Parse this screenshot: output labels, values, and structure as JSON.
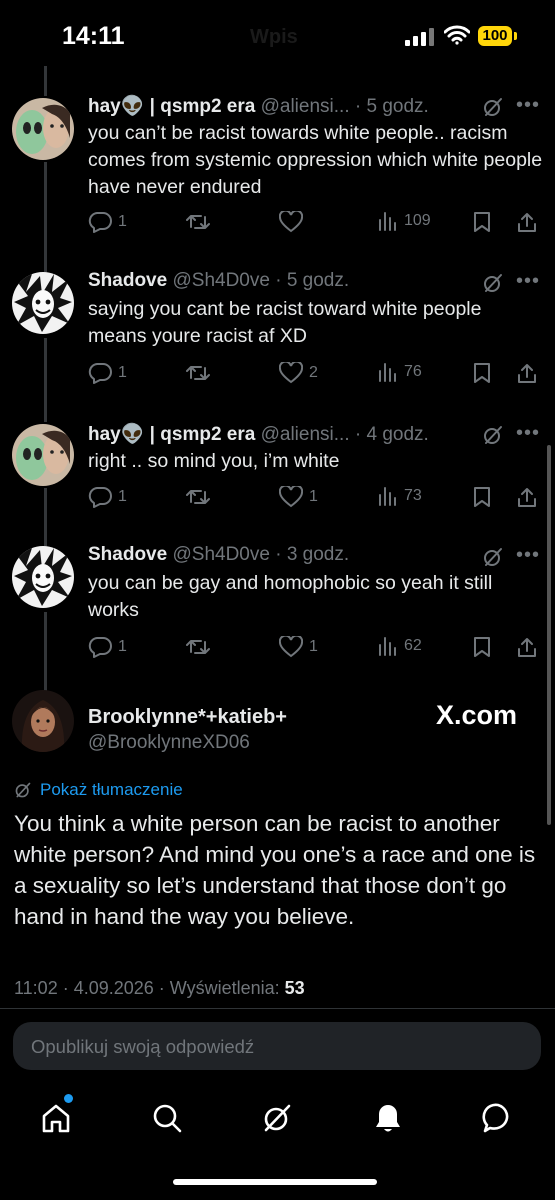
{
  "status_bar": {
    "time": "14:11",
    "battery": "100",
    "title": "Wpis"
  },
  "tweets": [
    {
      "name": "hay👽 | qsmp2 era",
      "handle": "@aliensi...",
      "time": "5 godz.",
      "text": "you can’t be racist towards white people.. racism comes from systemic oppression which white people have never endured",
      "replies": "1",
      "reposts": "",
      "likes": "",
      "views": "109"
    },
    {
      "name": "Shadove",
      "handle": "@Sh4D0ve",
      "time": "5 godz.",
      "text": "saying you cant be racist toward white people means youre racist af XD",
      "replies": "1",
      "reposts": "",
      "likes": "2",
      "views": "76"
    },
    {
      "name": "hay👽 | qsmp2 era",
      "handle": "@aliensi...",
      "time": "4 godz.",
      "text": "right .. so mind you, i’m white",
      "replies": "1",
      "reposts": "",
      "likes": "1",
      "views": "73"
    },
    {
      "name": "Shadove",
      "handle": "@Sh4D0ve",
      "time": "3 godz.",
      "text": "you can be gay and homophobic so yeah it still works",
      "replies": "1",
      "reposts": "",
      "likes": "1",
      "views": "62"
    }
  ],
  "main_tweet": {
    "name": "Brooklynne*+katieb+",
    "handle": "@BrooklynneXD06",
    "watermark": "X.com",
    "translate_label": "Pokaż tłumaczenie",
    "text": "You think a white person can be racist to another white person? And mind you one’s a race and one is a sexuality so let’s understand that those don’t go hand in hand the way you believe.",
    "time_date": "11:02 · 4.09.2026 · Wyświetlenia: ",
    "views": "53"
  },
  "reply_box": {
    "placeholder": "Opublikuj swoją odpowiedź"
  },
  "tabs": [
    "home-icon",
    "search-icon",
    "grok-icon",
    "notifications-icon",
    "messages-icon"
  ],
  "colors": {
    "accent": "#1d9bf0",
    "muted": "#71767b",
    "battery": "#ffd60a"
  }
}
